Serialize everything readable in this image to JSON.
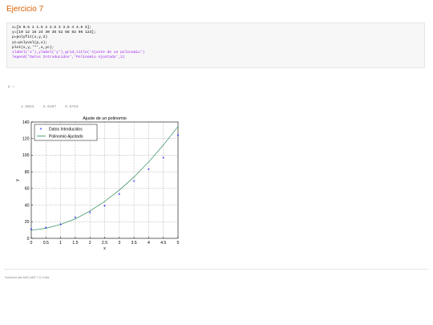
{
  "page": {
    "title": "Ejercicio 7",
    "code_lines": [
      {
        "text": "x=[0 0.5 1 1.5 2 2.5 3 3.5 4 4.5 5];",
        "color": "#000000"
      },
      {
        "text": "y=[10 12 16 24 30 38 52 68 82 96 123];",
        "color": "#000000"
      },
      {
        "text": "p=polyfit(x,y,2)",
        "color": "#000000"
      },
      {
        "text": "yc=polyval(p,x);",
        "color": "#000000"
      },
      {
        "text": "plot(x,y,'*',x,yc);",
        "color": "#000000"
      },
      {
        "text": "xlabel('x'),ylabel('y'),grid,title('Ajuste de un polinomio')",
        "color": "#a020f0"
      },
      {
        "text": "legend('Datos Introducidos','Polinomio Ajustado',2)",
        "color": "#a020f0"
      }
    ],
    "output_label": "p =",
    "output_values": "4.5023    2.6107    9.6783",
    "footer": "Published with MATLAB® 7.11.0 8ba"
  },
  "chart_data": {
    "type": "line",
    "title": "Ajuste de un polinomio",
    "xlabel": "x",
    "ylabel": "y",
    "xlim": [
      0,
      5
    ],
    "ylim": [
      0,
      140
    ],
    "xticks": [
      "0",
      "0.5",
      "1",
      "1.5",
      "2",
      "2.5",
      "3",
      "3.5",
      "4",
      "4.5",
      "5"
    ],
    "yticks": [
      "0",
      "20",
      "40",
      "60",
      "80",
      "100",
      "120",
      "140"
    ],
    "grid": true,
    "legend_position": "top-left",
    "x": [
      0,
      0.5,
      1,
      1.5,
      2,
      2.5,
      3,
      3.5,
      4,
      4.5,
      5
    ],
    "series": [
      {
        "name": "Datos Introducidos",
        "type": "scatter",
        "marker": "*",
        "color": "#0000ff",
        "values": [
          10,
          12,
          16,
          24,
          30,
          38,
          52,
          68,
          82,
          96,
          123
        ]
      },
      {
        "name": "Polinomio Ajustado",
        "type": "line",
        "color": "#2e8b57",
        "values": [
          9.7,
          12.1,
          16.7,
          23.4,
          32.9,
          44.4,
          58.0,
          73.8,
          91.9,
          112.2,
          134.5
        ]
      }
    ]
  }
}
